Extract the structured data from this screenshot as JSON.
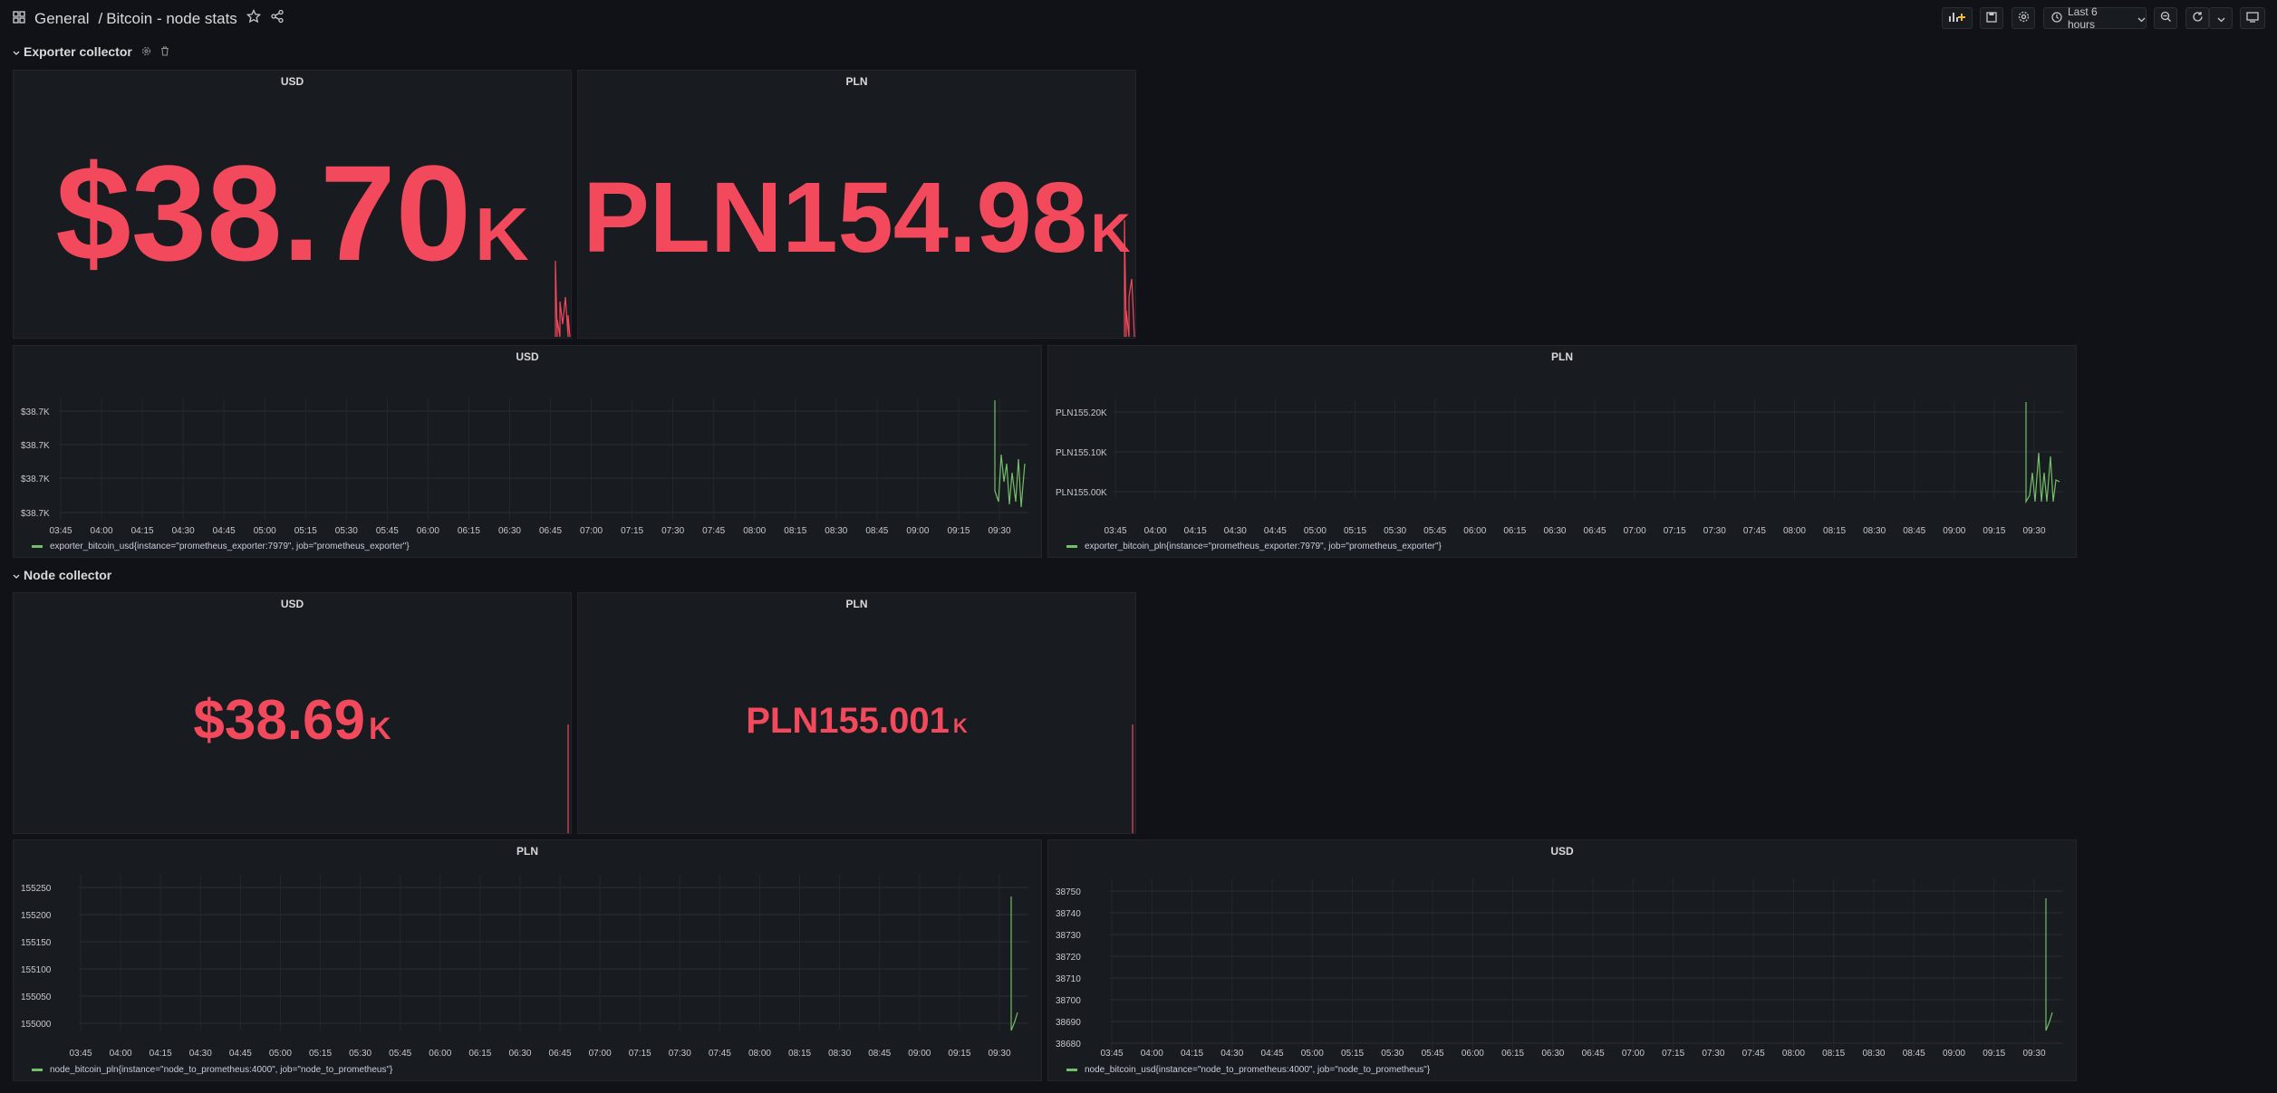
{
  "breadcrumb": {
    "root": "General",
    "separator": "/",
    "title": "Bitcoin - node stats"
  },
  "toolbar": {
    "time_range": "Last 6 hours"
  },
  "colors": {
    "stat": "#f2495c",
    "series": "#73bf69",
    "background": "#111217",
    "panel": "#181b1f"
  },
  "icons": [
    "apps-icon",
    "star-icon",
    "share-icon",
    "add-panel-icon",
    "save-icon",
    "settings-icon",
    "clock-icon",
    "chevron-down-icon",
    "zoom-out-icon",
    "refresh-icon",
    "tv-icon"
  ],
  "rows": [
    {
      "title": "Exporter collector"
    },
    {
      "title": "Node collector"
    }
  ],
  "stats": {
    "exp_usd": {
      "title": "USD",
      "value": "$38.70",
      "unit": "K"
    },
    "exp_pln": {
      "title": "PLN",
      "value": "PLN154.98",
      "unit": "K"
    },
    "node_usd": {
      "title": "USD",
      "value": "$38.69",
      "unit": "K"
    },
    "node_pln": {
      "title": "PLN",
      "value": "PLN155.001",
      "unit": "K"
    }
  },
  "x_ticks": [
    "03:45",
    "04:00",
    "04:15",
    "04:30",
    "04:45",
    "05:00",
    "05:15",
    "05:30",
    "05:45",
    "06:00",
    "06:15",
    "06:30",
    "06:45",
    "07:00",
    "07:15",
    "07:30",
    "07:45",
    "08:00",
    "08:15",
    "08:30",
    "08:45",
    "09:00",
    "09:15",
    "09:30"
  ],
  "timeseries": {
    "exp_usd": {
      "title": "USD",
      "y_ticks": [
        "$38.7K",
        "$38.7K",
        "$38.7K",
        "$38.7K"
      ],
      "legend": "exporter_bitcoin_usd{instance=\"prometheus_exporter:7979\", job=\"prometheus_exporter\"}"
    },
    "exp_pln": {
      "title": "PLN",
      "y_ticks": [
        "PLN155.20K",
        "PLN155.10K",
        "PLN155.00K"
      ],
      "legend": "exporter_bitcoin_pln{instance=\"prometheus_exporter:7979\", job=\"prometheus_exporter\"}"
    },
    "node_pln": {
      "title": "PLN",
      "y_ticks": [
        "155250",
        "155200",
        "155150",
        "155100",
        "155050",
        "155000"
      ],
      "legend": "node_bitcoin_pln{instance=\"node_to_prometheus:4000\", job=\"node_to_prometheus\"}"
    },
    "node_usd": {
      "title": "USD",
      "y_ticks": [
        "38750",
        "38740",
        "38730",
        "38720",
        "38710",
        "38700",
        "38690",
        "38680"
      ],
      "legend": "node_bitcoin_usd{instance=\"node_to_prometheus:4000\", job=\"node_to_prometheus\"}"
    }
  }
}
